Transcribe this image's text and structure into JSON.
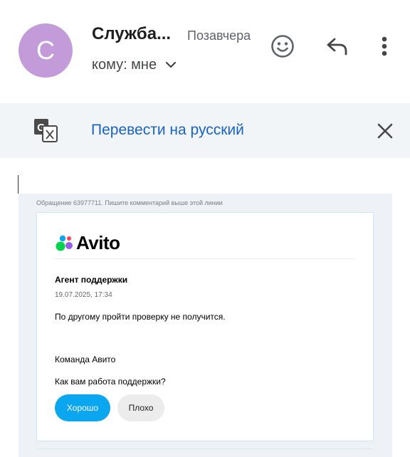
{
  "header": {
    "avatar_letter": "С",
    "sender_name": "Служба...",
    "date": "Позавчера",
    "recipient": "кому: мне",
    "avatar_color": "#c49bd9",
    "icons": [
      "emoji-icon",
      "reply-icon",
      "more-vert-icon",
      "chevron-down-icon"
    ]
  },
  "translate": {
    "label": "Перевести на русский",
    "icons": [
      "google-translate-icon",
      "close-icon"
    ],
    "link_color": "#1a63c5"
  },
  "email": {
    "ticket_note": "Обращение 63977711. Пишите комментарий выше этой линии",
    "logo_text": "Avito",
    "agent_title": "Агент поддержки",
    "agent_date": "19.07.2025, 17:34",
    "message": "По другому пройти проверку не получится.",
    "signature": "Команда Авито",
    "feedback_question": "Как вам работа поддержки?",
    "buttons": {
      "good": "Хорошо",
      "bad": "Плохо"
    },
    "accent_color": "#0aa6ef"
  }
}
